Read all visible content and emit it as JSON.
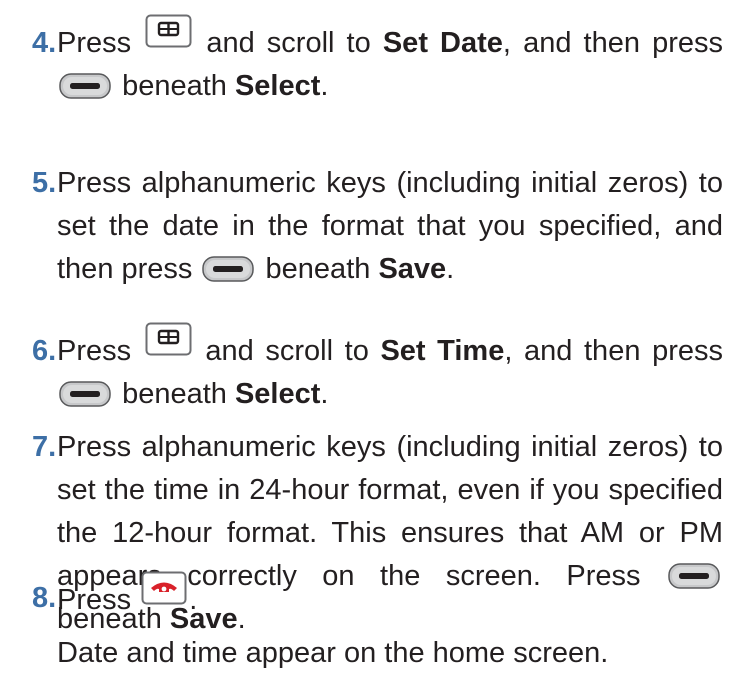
{
  "steps": [
    {
      "number": "4.",
      "parts": [
        "Press",
        "and scroll to",
        "Set Date",
        ", and then",
        "press",
        "beneath",
        "Select",
        "."
      ]
    },
    {
      "number": "5.",
      "text_a": "Press alphanumeric keys (including initial zeros) to set the date in the format that you specified, and then press",
      "text_b": "beneath",
      "bold": "Save",
      "end": "."
    },
    {
      "number": "6.",
      "parts": [
        "Press",
        "and scroll to",
        "Set Time",
        ", and then",
        "press",
        "beneath",
        "Select",
        "."
      ]
    },
    {
      "number": "7.",
      "text_a": "Press alphanumeric keys (including initial zeros) to set the time in 24-hour format, even if you specified the 12-hour format. This ensures that AM or PM appears correctly on the screen. Press",
      "text_b": "beneath",
      "bold": "Save",
      "end": "."
    },
    {
      "number": "8.",
      "text_a": "Press",
      "end": "."
    }
  ],
  "note": "Date and time appear on the home screen.",
  "icons": {
    "menu": "menu-key-icon",
    "soft": "soft-key-icon",
    "end_call": "end-call-key-icon"
  },
  "colors": {
    "step_number": "#3d6fa6",
    "end_key_red": "#d9212a"
  }
}
